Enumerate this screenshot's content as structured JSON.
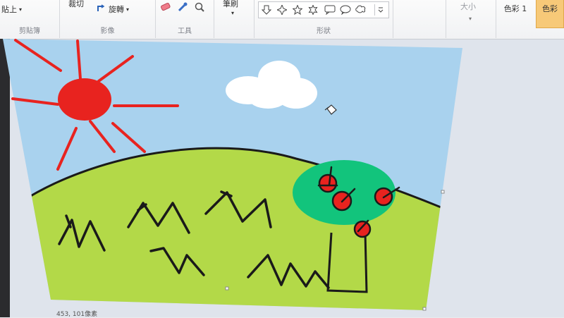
{
  "ribbon": {
    "clipboard": {
      "label": "剪貼簿",
      "paste_label": "貼上"
    },
    "image": {
      "label": "影像",
      "crop_label": "裁切",
      "rotate_label": "旋轉"
    },
    "tools": {
      "label": "工具"
    },
    "brushes": {
      "label": "筆刷"
    },
    "shapes": {
      "label": "形狀"
    },
    "size": {
      "label": "大小"
    },
    "color1": {
      "label": "色彩 1"
    },
    "color2": {
      "label": "色彩"
    }
  },
  "status": {
    "coords": "453, 101像素"
  },
  "colors": {
    "sky": "#a9d2ee",
    "hill": "#b3d948",
    "sun": "#e8231f",
    "tree": "#12c47c",
    "apple": "#e8231f",
    "cloud": "#ffffff",
    "line": "#1a1a1a",
    "color2_highlight": "#f7c978"
  }
}
